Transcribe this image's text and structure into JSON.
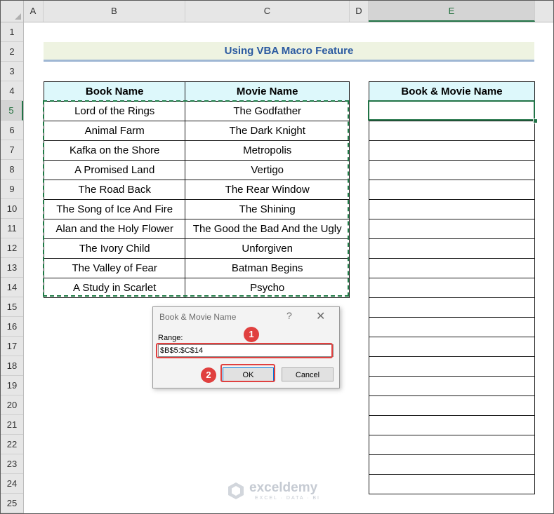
{
  "columns": [
    "A",
    "B",
    "C",
    "D",
    "E"
  ],
  "selected_column": "E",
  "rows": [
    "1",
    "2",
    "3",
    "4",
    "5",
    "6",
    "7",
    "8",
    "9",
    "10",
    "11",
    "12",
    "13",
    "14",
    "15",
    "16",
    "17",
    "18",
    "19",
    "20",
    "21",
    "22",
    "23",
    "24",
    "25"
  ],
  "selected_row": "5",
  "title": "Using VBA Macro Feature",
  "table": {
    "headers": [
      "Book Name",
      "Movie Name"
    ],
    "rows": [
      [
        "Lord of the Rings",
        "The Godfather"
      ],
      [
        "Animal Farm",
        "The Dark Knight"
      ],
      [
        "Kafka on the Shore",
        "Metropolis"
      ],
      [
        "A Promised Land",
        "Vertigo"
      ],
      [
        "The Road Back",
        "The Rear Window"
      ],
      [
        "The Song of Ice And Fire",
        "The Shining"
      ],
      [
        "Alan and the Holy Flower",
        "The Good the Bad And the Ugly"
      ],
      [
        "The Ivory Child",
        "Unforgiven"
      ],
      [
        "The Valley of Fear",
        "Batman Begins"
      ],
      [
        "A Study in Scarlet",
        "Psycho"
      ]
    ]
  },
  "output_table": {
    "header": "Book & Movie Name",
    "empty_rows": 20
  },
  "dialog": {
    "title": "Book & Movie Name",
    "help": "?",
    "close": "✕",
    "range_label": "Range:",
    "range_value": "$B$5:$C$14",
    "ok_label": "OK",
    "cancel_label": "Cancel"
  },
  "steps": [
    "1",
    "2"
  ],
  "watermark": {
    "name": "exceldemy",
    "tagline": "EXCEL · DATA · BI"
  },
  "colors": {
    "header_fill": "#ddf8fb",
    "title_fill": "#eef3e1",
    "title_text": "#2b5aa0",
    "marquee": "#1e7a45",
    "highlight": "#e0403f"
  }
}
